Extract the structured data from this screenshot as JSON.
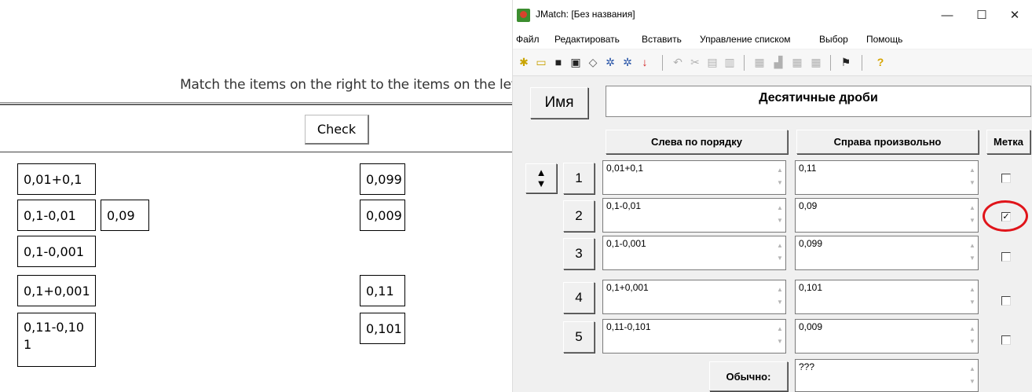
{
  "web": {
    "instruction": "Match the items on the right to the items on the left.",
    "check_label": "Check",
    "left_items": [
      "0,01+0,1",
      "0,1-0,01",
      "0,1-0,001",
      "0,1+0,001",
      "0,11-0,101"
    ],
    "placed_answer": "0,09",
    "right_items": [
      "0,099",
      "0,009",
      "0,11",
      "0,101"
    ]
  },
  "window": {
    "title": "JMatch: [Без названия]",
    "controls": {
      "minimize": "—",
      "maximize": "☐",
      "close": "✕"
    },
    "menu": [
      "Файл",
      "Редактировать",
      "Вставить",
      "Управление списком",
      "Выбор",
      "Помощь"
    ],
    "toolbar_icons": [
      "new-file-icon",
      "open-folder-icon",
      "save-icon",
      "save-as-icon",
      "eraser-icon",
      "web-export-icon",
      "web-export-alt-icon",
      "down-arrow-icon",
      "undo-icon",
      "cut-icon",
      "copy-icon",
      "paste-icon",
      "tool-icon-1",
      "tool-icon-2",
      "tool-icon-3",
      "tool-icon-4",
      "flag-icon",
      "help-icon"
    ]
  },
  "editor": {
    "name_label": "Имя",
    "title": "Десятичные дроби",
    "col_left": "Слева по порядку",
    "col_right": "Справа произвольно",
    "col_mark": "Метка",
    "rows": [
      {
        "num": "1",
        "left": "0,01+0,1",
        "right": "0,11",
        "checked": false
      },
      {
        "num": "2",
        "left": "0,1-0,01",
        "right": "0,09",
        "checked": true
      },
      {
        "num": "3",
        "left": "0,1-0,001",
        "right": "0,099",
        "checked": false
      },
      {
        "num": "4",
        "left": "0,1+0,001",
        "right": "0,101",
        "checked": false
      },
      {
        "num": "5",
        "left": "0,11-0,101",
        "right": "0,009",
        "checked": false
      }
    ],
    "default_label": "Обычно:",
    "default_value": "???",
    "check_mark": "✓",
    "scroll_up": "▲",
    "scroll_down": "▼"
  },
  "colors": {
    "highlight_circle": "#e0141a",
    "window_bg": "#f0f0f0"
  }
}
